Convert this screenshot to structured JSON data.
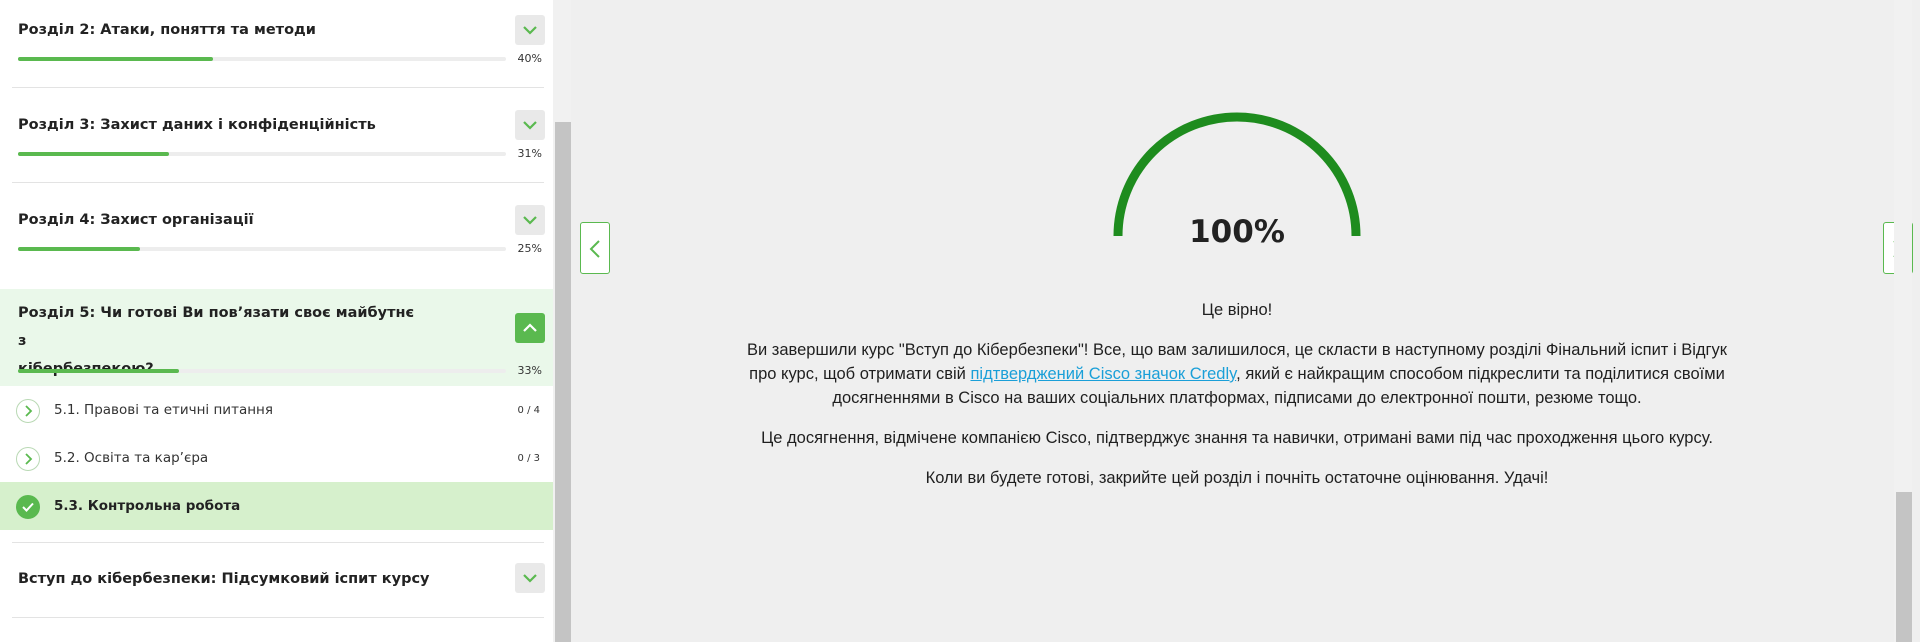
{
  "sidebar": {
    "sections": [
      {
        "title": "Розділ 2: Атаки, поняття та методи",
        "percent": "40%",
        "progress": 0.4,
        "expanded": false
      },
      {
        "title": "Розділ 3: Захист даних і конфіденційність",
        "percent": "31%",
        "progress": 0.31,
        "expanded": false
      },
      {
        "title": "Розділ 4: Захист організації",
        "percent": "25%",
        "progress": 0.25,
        "expanded": false
      },
      {
        "title_line1": "Розділ 5: Чи готові Ви пов’язати своє майбутнє з",
        "title_line2": "кібербезпекою?",
        "percent": "33%",
        "progress": 0.33,
        "expanded": true
      },
      {
        "title": "Вступ до кібербезпеки: Підсумковий іспит курсу",
        "expanded": false
      }
    ],
    "subitems": [
      {
        "label": "5.1. Правові та етичні питання",
        "count": "0 / 4",
        "status": "not-started"
      },
      {
        "label": "5.2. Освіта та кар’єра",
        "count": "0 / 3",
        "status": "not-started"
      },
      {
        "label": "5.3. Контрольна робота",
        "status": "completed"
      }
    ]
  },
  "main": {
    "score_value": "100%",
    "score_progress": 1.0,
    "feedback": "Це вірно!",
    "paragraph1_before_link": "Ви завершили курс \"Вступ до Кібербезпеки\"! Все, що вам залишилося, це скласти в наступному розділі Фінальний іспит і Відгук про курс, щоб отримати свій ",
    "paragraph1_link": "підтверджений Cisco значок Credly",
    "paragraph1_after_link": ", який є найкращим способом підкреслити та поділитися своїми досягненнями в Cisco на ваших соціальних платформах, підписами до електронної пошти, резюме тощо.",
    "paragraph2": "Це досягнення, відмічене компанією Cisco, підтверджує знання та навички, отримані вами під час проходження цього курсу.",
    "paragraph3": "Коли ви будете готові, закрийте цей розділ і почніть остаточне оцінювання. Удачі!"
  },
  "colors": {
    "accent": "#5ab94f",
    "gauge": "#1e8c1e",
    "link": "#1a9fd8",
    "active_section_bg": "#eaf8ea",
    "completed_item_bg": "#d6f0cc"
  },
  "icons": {
    "expand": "chevron-down-icon",
    "collapse": "chevron-up-icon",
    "subitem": "chevron-right-icon",
    "completed": "check-icon",
    "prev": "chevron-left-icon",
    "next": "chevron-right-icon"
  }
}
